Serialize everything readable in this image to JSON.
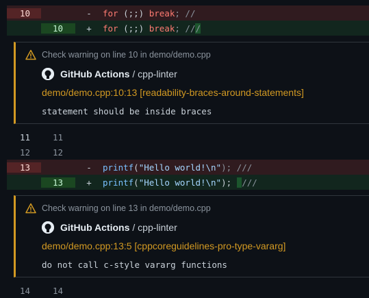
{
  "diff": {
    "hunk1": {
      "del": {
        "old_num": "10",
        "sign": "-",
        "code_a": "for",
        "code_b": " (;;) ",
        "code_c": "break",
        "code_d": "; //"
      },
      "add": {
        "new_num": "10",
        "sign": "+",
        "code_a": "for",
        "code_b": " (;;) ",
        "code_c": "break",
        "code_d": "; //",
        "code_e": "/"
      }
    },
    "annotation1": {
      "title": "Check warning on line 10 in demo/demo.cpp",
      "source_bold": "GitHub Actions",
      "source_rest": "/ cpp-linter",
      "check": "demo/demo.cpp:10:13 [readability-braces-around-statements]",
      "message": "statement should be inside braces"
    },
    "ctx1": {
      "old": "11",
      "new": "11"
    },
    "ctx2": {
      "old": "12",
      "new": "12"
    },
    "hunk2": {
      "del": {
        "old_num": "13",
        "sign": "-",
        "fn": "printf",
        "p1": "(",
        "str": "\"Hello world!\\n\"",
        "p2": "); ///"
      },
      "add": {
        "new_num": "13",
        "sign": "+",
        "fn": "printf",
        "p1": "(",
        "str": "\"Hello world!\\n\"",
        "p2": "); ",
        "hl": " ",
        "p3": "///"
      }
    },
    "annotation2": {
      "title": "Check warning on line 13 in demo/demo.cpp",
      "source_bold": "GitHub Actions",
      "source_rest": "/ cpp-linter",
      "check": "demo/demo.cpp:13:5 [cppcoreguidelines-pro-type-vararg]",
      "message": "do not call c-style vararg functions"
    },
    "ctx3": {
      "old": "14",
      "new": "14"
    }
  },
  "colors": {
    "warning": "#d29922",
    "deletion_bg": "#301b1f",
    "addition_bg": "#12261e"
  }
}
